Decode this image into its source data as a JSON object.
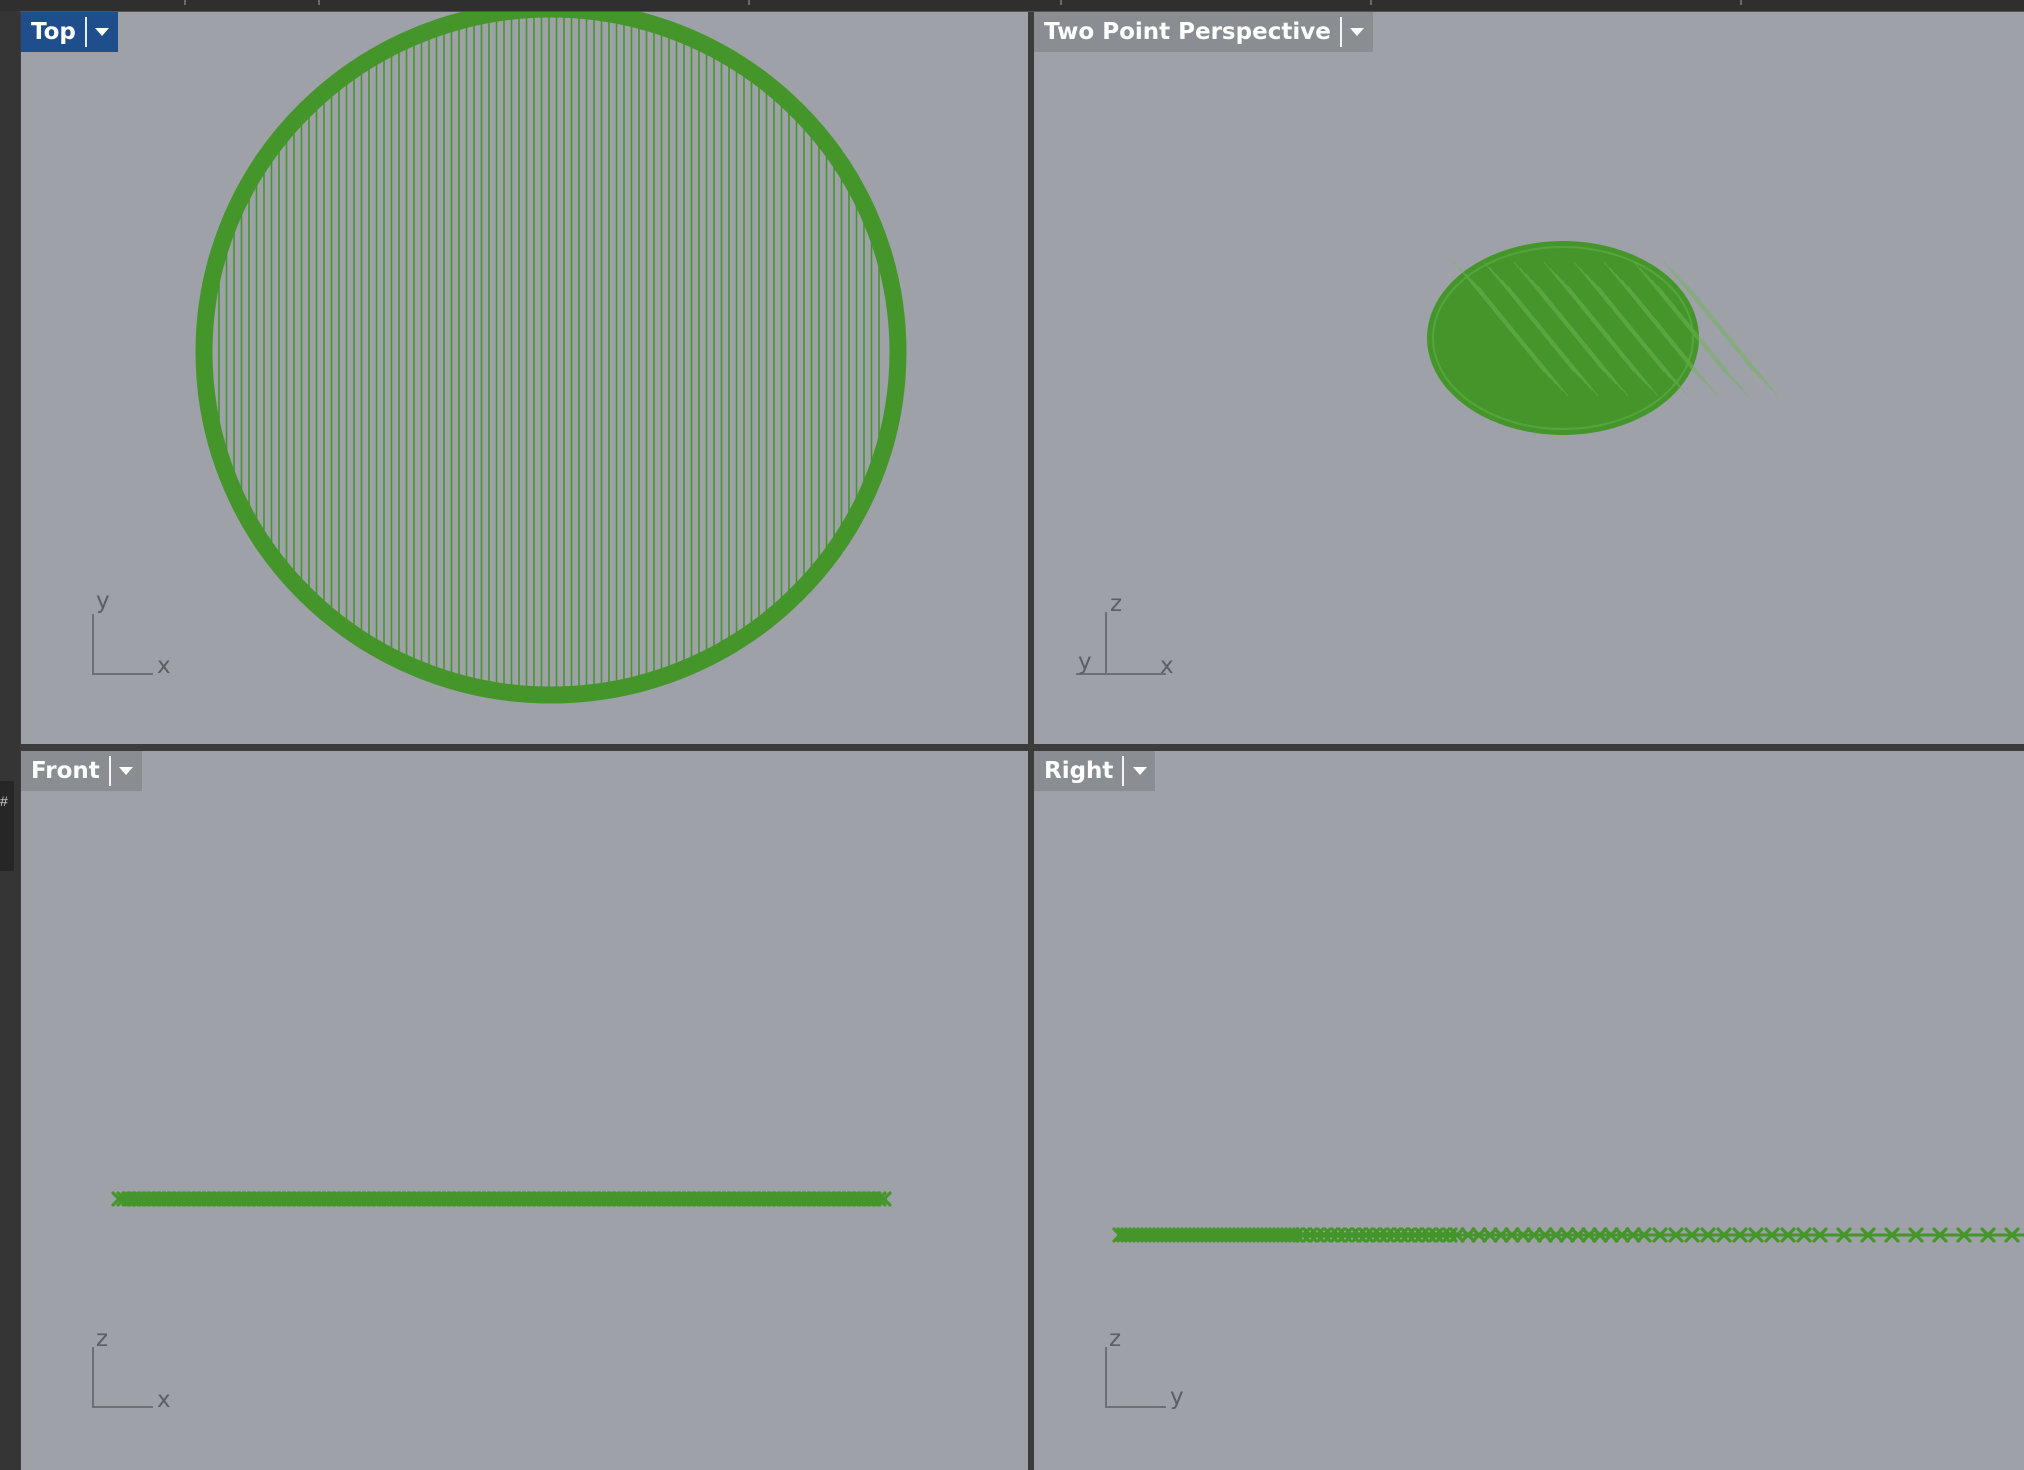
{
  "colors": {
    "viewport_bg": "#9ea1a7",
    "geometry": "#45962a",
    "active_tab": "#1f4e8c",
    "inactive_tab": "#8a8d92",
    "axis": "#6c6f74",
    "frame": "#3c3c3c"
  },
  "viewports": {
    "top": {
      "title": "Top",
      "active": true,
      "axis_horizontal": "x",
      "axis_vertical": "y"
    },
    "perspective": {
      "title": "Two Point Perspective",
      "active": false,
      "axis_horizontal": "x",
      "axis_vertical": "z",
      "axis_depth": "y"
    },
    "front": {
      "title": "Front",
      "active": false,
      "axis_horizontal": "x",
      "axis_vertical": "z"
    },
    "right": {
      "title": "Right",
      "active": false,
      "axis_horizontal": "y",
      "axis_vertical": "z"
    }
  },
  "icons": {
    "dropdown": "chevron-down-icon"
  }
}
